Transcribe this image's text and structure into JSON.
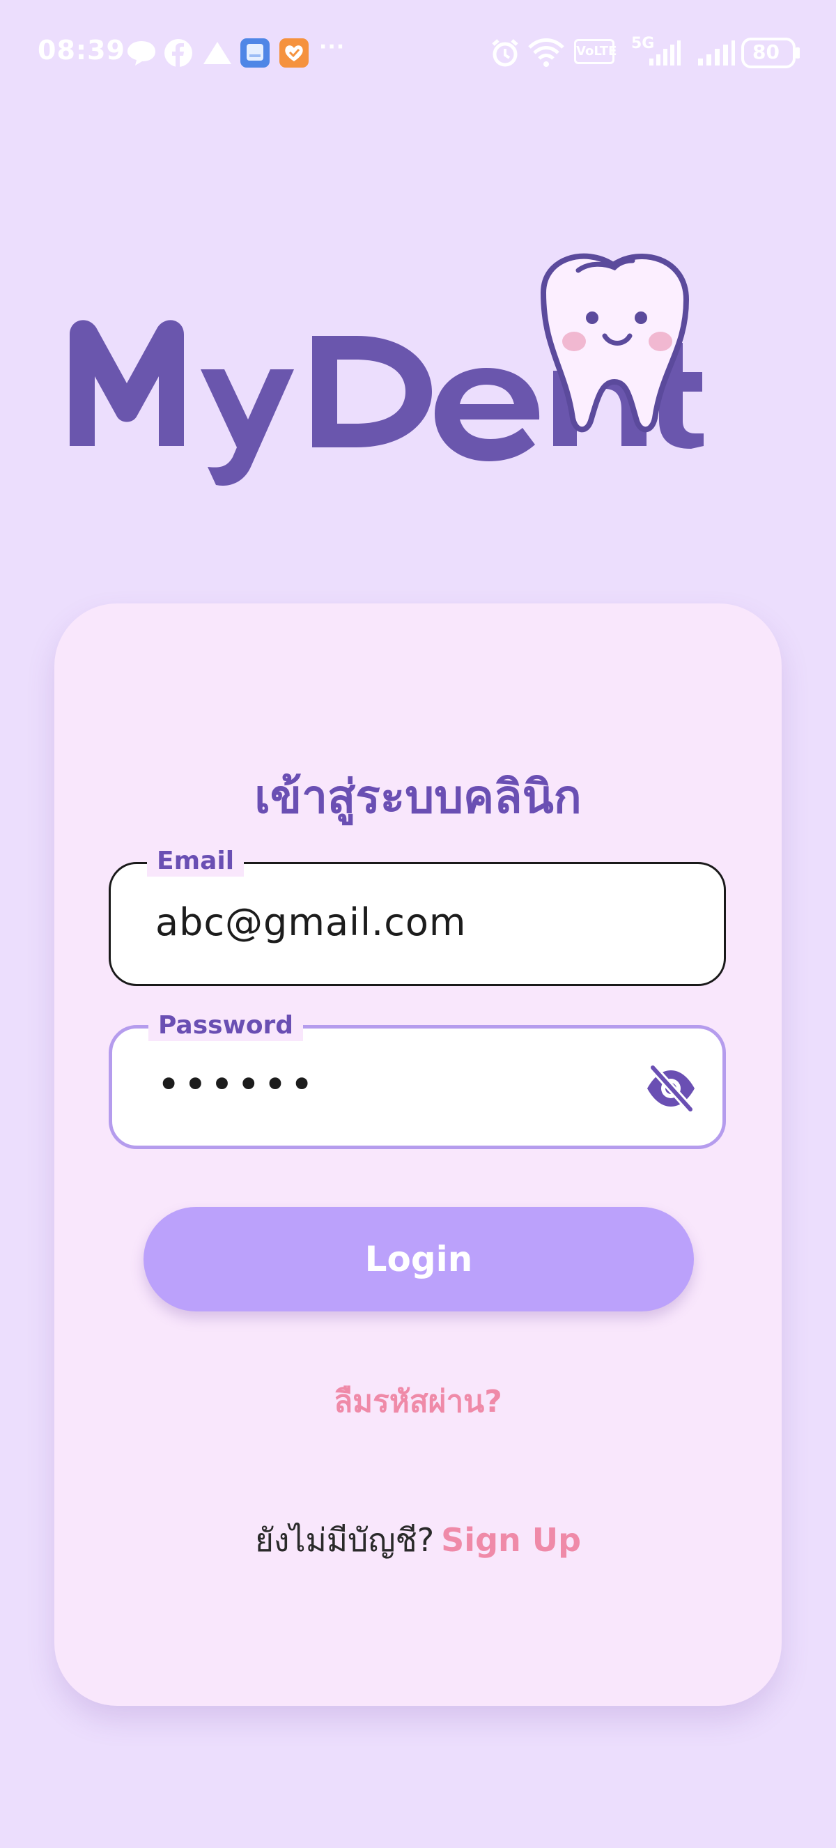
{
  "status_bar": {
    "time": "08:39",
    "battery": "80",
    "network_label": "VoLTE",
    "network_gen": "5G",
    "more": "···"
  },
  "logo": {
    "text": "MyDent"
  },
  "login_card": {
    "title": "เข้าสู่ระบบคลินิก",
    "email": {
      "label": "Email",
      "value": "abc@gmail.com"
    },
    "password": {
      "label": "Password",
      "value": "••••••"
    },
    "login_button": "Login",
    "forgot_password": "ลืมรหัสผ่าน?",
    "no_account_prompt": "ยังไม่มีบัญชี?",
    "sign_up": "Sign Up"
  },
  "colors": {
    "background": "#ecdefd",
    "card": "#f9e7fc",
    "primary_purple": "#6a4fb3",
    "button": "#bba1fb",
    "link_pink": "#ef8aa8",
    "focused_border": "#b59ced"
  },
  "icons": {
    "password_toggle": "eye-off-icon",
    "status": [
      "chat-bubble-icon",
      "facebook-icon",
      "navigation-icon",
      "gallery-app-icon",
      "heart-app-icon",
      "alarm-icon",
      "wifi-icon",
      "signal-icon"
    ]
  }
}
